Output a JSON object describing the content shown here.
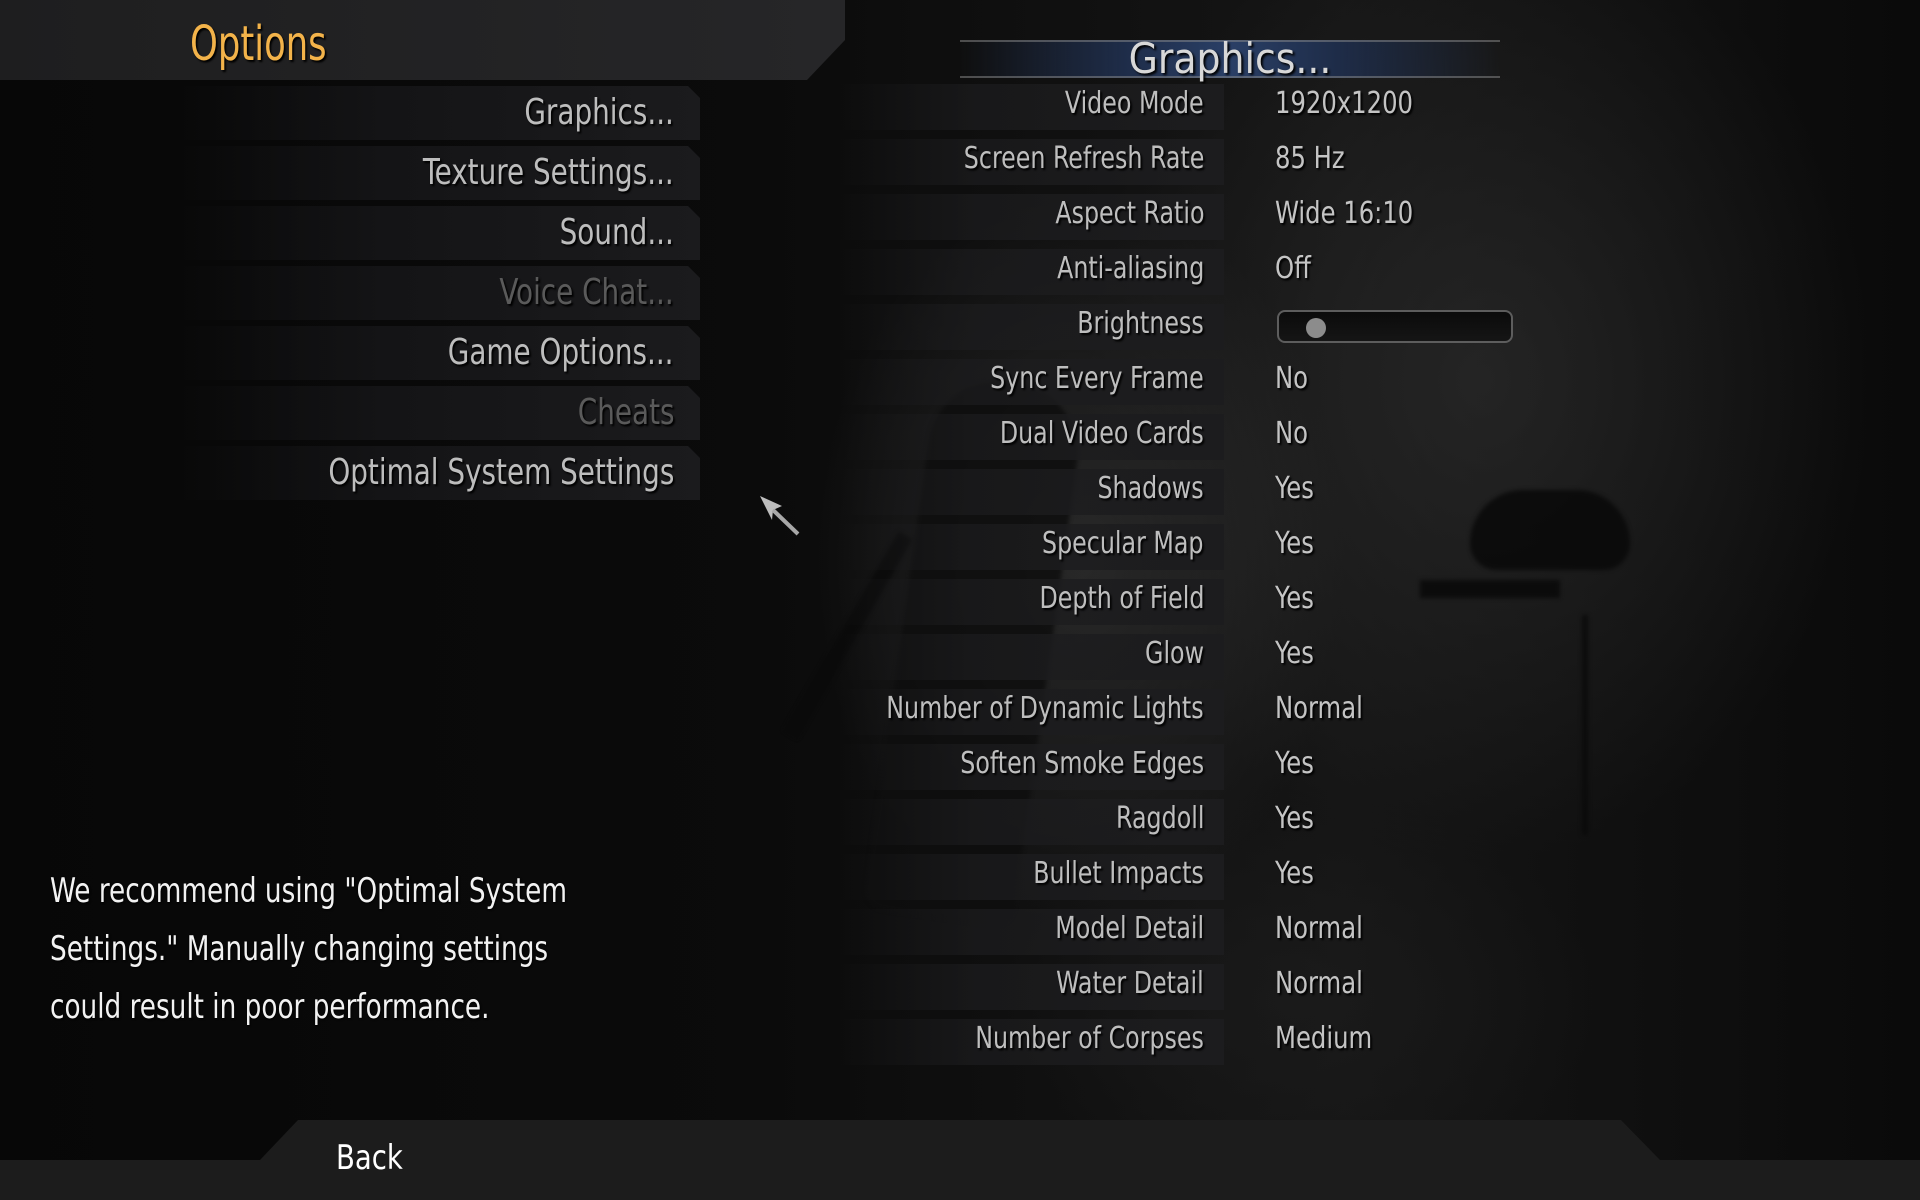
{
  "header": {
    "title": "Options"
  },
  "menu": {
    "items": [
      {
        "label": "Graphics...",
        "enabled": true
      },
      {
        "label": "Texture Settings...",
        "enabled": true
      },
      {
        "label": "Sound...",
        "enabled": true
      },
      {
        "label": "Voice Chat...",
        "enabled": false
      },
      {
        "label": "Game Options...",
        "enabled": true
      },
      {
        "label": "Cheats",
        "enabled": false
      },
      {
        "label": "Optimal System Settings",
        "enabled": true
      }
    ]
  },
  "hint": {
    "text": "We recommend using \"Optimal System Settings.\"  Manually changing settings could result in poor performance."
  },
  "section": {
    "title": "Graphics...",
    "settings": [
      {
        "label": "Video Mode",
        "value": "1920x1200"
      },
      {
        "label": "Screen Refresh Rate",
        "value": "85 Hz"
      },
      {
        "label": "Aspect Ratio",
        "value": "Wide 16:10"
      },
      {
        "label": "Anti-aliasing",
        "value": "Off"
      },
      {
        "label": "Brightness",
        "type": "slider",
        "value": 0.12
      },
      {
        "label": "Sync Every Frame",
        "value": "No"
      },
      {
        "label": "Dual Video Cards",
        "value": "No"
      },
      {
        "label": "Shadows",
        "value": "Yes"
      },
      {
        "label": "Specular Map",
        "value": "Yes"
      },
      {
        "label": "Depth of Field",
        "value": "Yes"
      },
      {
        "label": "Glow",
        "value": "Yes"
      },
      {
        "label": "Number of Dynamic Lights",
        "value": "Normal"
      },
      {
        "label": "Soften Smoke Edges",
        "value": "Yes"
      },
      {
        "label": "Ragdoll",
        "value": "Yes"
      },
      {
        "label": "Bullet Impacts",
        "value": "Yes"
      },
      {
        "label": "Model Detail",
        "value": "Normal"
      },
      {
        "label": "Water Detail",
        "value": "Normal"
      },
      {
        "label": "Number of Corpses",
        "value": "Medium"
      }
    ]
  },
  "footer": {
    "back_label": "Back"
  },
  "colors": {
    "title_accent": "#f3b34a",
    "section_header_blue": "#2a3f66",
    "disabled_text": "#5a5a5a"
  }
}
